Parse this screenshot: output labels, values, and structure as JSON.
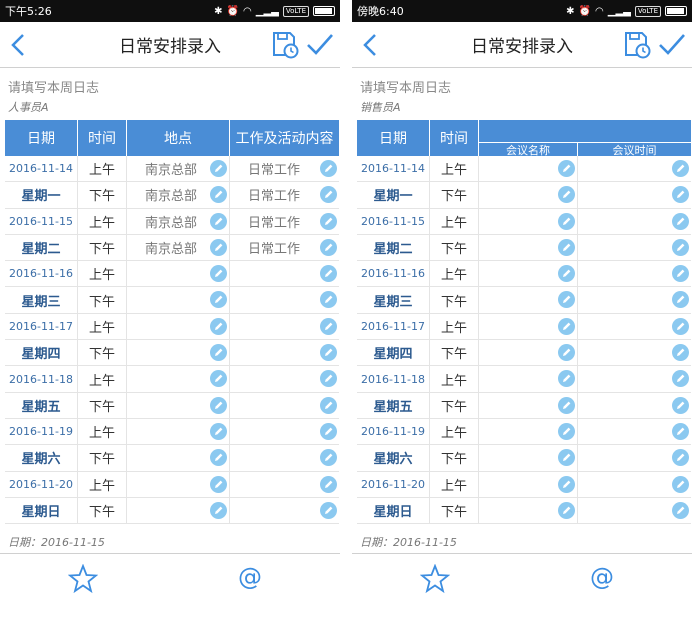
{
  "colors": {
    "accent": "#3c8de0",
    "header_bg": "#4a8dd6",
    "pen_icon": "#8bc9f0"
  },
  "screens": [
    {
      "status_time": "下午5:26",
      "status_volte": "VoLTE",
      "title": "日常安排录入",
      "prompt": "请填写本周日志",
      "person": "人事员A",
      "footer_date": "日期：2016-11-15",
      "columns": [
        "日期",
        "时间",
        "地点",
        "工作及活动内容"
      ],
      "rows": [
        {
          "c0": "2016-11-14",
          "c1": "上午",
          "c2": "南京总部",
          "c3": "日常工作"
        },
        {
          "c0": "星期一",
          "c1": "下午",
          "c2": "南京总部",
          "c3": "日常工作"
        },
        {
          "c0": "2016-11-15",
          "c1": "上午",
          "c2": "南京总部",
          "c3": "日常工作"
        },
        {
          "c0": "星期二",
          "c1": "下午",
          "c2": "南京总部",
          "c3": "日常工作"
        },
        {
          "c0": "2016-11-16",
          "c1": "上午",
          "c2": "",
          "c3": ""
        },
        {
          "c0": "星期三",
          "c1": "下午",
          "c2": "",
          "c3": ""
        },
        {
          "c0": "2016-11-17",
          "c1": "上午",
          "c2": "",
          "c3": ""
        },
        {
          "c0": "星期四",
          "c1": "下午",
          "c2": "",
          "c3": ""
        },
        {
          "c0": "2016-11-18",
          "c1": "上午",
          "c2": "",
          "c3": ""
        },
        {
          "c0": "星期五",
          "c1": "下午",
          "c2": "",
          "c3": ""
        },
        {
          "c0": "2016-11-19",
          "c1": "上午",
          "c2": "",
          "c3": ""
        },
        {
          "c0": "星期六",
          "c1": "下午",
          "c2": "",
          "c3": ""
        },
        {
          "c0": "2016-11-20",
          "c1": "上午",
          "c2": "",
          "c3": ""
        },
        {
          "c0": "星期日",
          "c1": "下午",
          "c2": "",
          "c3": ""
        }
      ]
    },
    {
      "status_time": "傍晚6:40",
      "status_volte": "VoLTE",
      "title": "日常安排录入",
      "prompt": "请填写本周日志",
      "person": "销售员A",
      "footer_date": "日期：2016-11-15",
      "columns": [
        "日期",
        "时间",
        "会议名称",
        "会议时间"
      ],
      "rows": [
        {
          "c0": "2016-11-14",
          "c1": "上午",
          "c2": "",
          "c3": ""
        },
        {
          "c0": "星期一",
          "c1": "下午",
          "c2": "",
          "c3": ""
        },
        {
          "c0": "2016-11-15",
          "c1": "上午",
          "c2": "",
          "c3": ""
        },
        {
          "c0": "星期二",
          "c1": "下午",
          "c2": "",
          "c3": ""
        },
        {
          "c0": "2016-11-16",
          "c1": "上午",
          "c2": "",
          "c3": ""
        },
        {
          "c0": "星期三",
          "c1": "下午",
          "c2": "",
          "c3": ""
        },
        {
          "c0": "2016-11-17",
          "c1": "上午",
          "c2": "",
          "c3": ""
        },
        {
          "c0": "星期四",
          "c1": "下午",
          "c2": "",
          "c3": ""
        },
        {
          "c0": "2016-11-18",
          "c1": "上午",
          "c2": "",
          "c3": ""
        },
        {
          "c0": "星期五",
          "c1": "下午",
          "c2": "",
          "c3": ""
        },
        {
          "c0": "2016-11-19",
          "c1": "上午",
          "c2": "",
          "c3": ""
        },
        {
          "c0": "星期六",
          "c1": "下午",
          "c2": "",
          "c3": ""
        },
        {
          "c0": "2016-11-20",
          "c1": "上午",
          "c2": "",
          "c3": ""
        },
        {
          "c0": "星期日",
          "c1": "下午",
          "c2": "",
          "c3": ""
        }
      ]
    }
  ]
}
